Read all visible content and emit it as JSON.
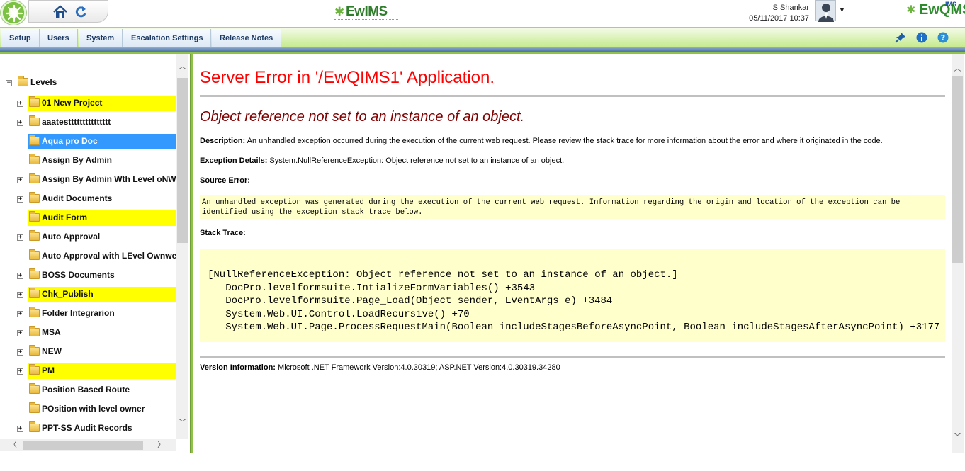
{
  "header": {
    "brand_center": "EwIMS",
    "brand_right": "EwQMS",
    "brand_right_sup": "IMS",
    "user_name": "S Shankar",
    "user_datetime": "05/11/2017 10:37"
  },
  "menu": {
    "items": [
      "Setup",
      "Users",
      "System",
      "Escalation Settings",
      "Release Notes"
    ]
  },
  "tree": {
    "root": "Levels",
    "items": [
      {
        "label": "01 New Project",
        "expander": "+",
        "style": "highlight"
      },
      {
        "label": "aaatesttttttttttttttt",
        "expander": "+",
        "style": "normal"
      },
      {
        "label": "Aqua pro Doc",
        "expander": "",
        "style": "selected"
      },
      {
        "label": "Assign By Admin",
        "expander": "",
        "style": "normal"
      },
      {
        "label": "Assign By Admin Wth Level oNW",
        "expander": "+",
        "style": "normal"
      },
      {
        "label": "Audit Documents",
        "expander": "+",
        "style": "normal"
      },
      {
        "label": "Audit Form",
        "expander": "",
        "style": "highlight"
      },
      {
        "label": "Auto Approval",
        "expander": "+",
        "style": "normal"
      },
      {
        "label": "Auto Approval with LEvel Ownwe",
        "expander": "",
        "style": "normal"
      },
      {
        "label": "BOSS Documents",
        "expander": "+",
        "style": "normal"
      },
      {
        "label": "Chk_Publish",
        "expander": "+",
        "style": "highlight"
      },
      {
        "label": "Folder Integrarion",
        "expander": "+",
        "style": "normal"
      },
      {
        "label": "MSA",
        "expander": "+",
        "style": "normal"
      },
      {
        "label": "NEW",
        "expander": "+",
        "style": "normal"
      },
      {
        "label": "PM",
        "expander": "+",
        "style": "highlight"
      },
      {
        "label": "Position Based Route",
        "expander": "",
        "style": "normal"
      },
      {
        "label": "POsition with level owner",
        "expander": "",
        "style": "normal"
      },
      {
        "label": "PPT-SS Audit Records",
        "expander": "+",
        "style": "normal"
      }
    ]
  },
  "error": {
    "title": "Server Error in '/EwQIMS1' Application.",
    "message": "Object reference not set to an instance of an object.",
    "description_label": "Description:",
    "description_text": " An unhandled exception occurred during the execution of the current web request. Please review the stack trace for more information about the error and where it originated in the code.",
    "exception_label": "Exception Details:",
    "exception_text": " System.NullReferenceException: Object reference not set to an instance of an object.",
    "source_error_label": "Source Error:",
    "source_error_line1": "An unhandled exception was generated during the execution of the current web request. Information regarding the origin and location of the exception can be",
    "source_error_line2": "identified using the exception stack trace below.",
    "stack_label": "Stack Trace:",
    "stack_lines": [
      "[NullReferenceException: Object reference not set to an instance of an object.]",
      "   DocPro.levelformsuite.IntializeFormVariables() +3543",
      "   DocPro.levelformsuite.Page_Load(Object sender, EventArgs e) +3484",
      "   System.Web.UI.Control.LoadRecursive() +70",
      "   System.Web.UI.Page.ProcessRequestMain(Boolean includeStagesBeforeAsyncPoint, Boolean includeStagesAfterAsyncPoint) +3177"
    ],
    "version_label": "Version Information:",
    "version_text": " Microsoft .NET Framework Version:4.0.30319; ASP.NET Version:4.0.30319.34280"
  },
  "colors": {
    "highlight": "#ffff00",
    "selected": "#3399ff",
    "error_title": "#ff0000",
    "error_message": "#800000",
    "code_background": "#ffffcc",
    "menubar_green": "#c5ea8c"
  }
}
